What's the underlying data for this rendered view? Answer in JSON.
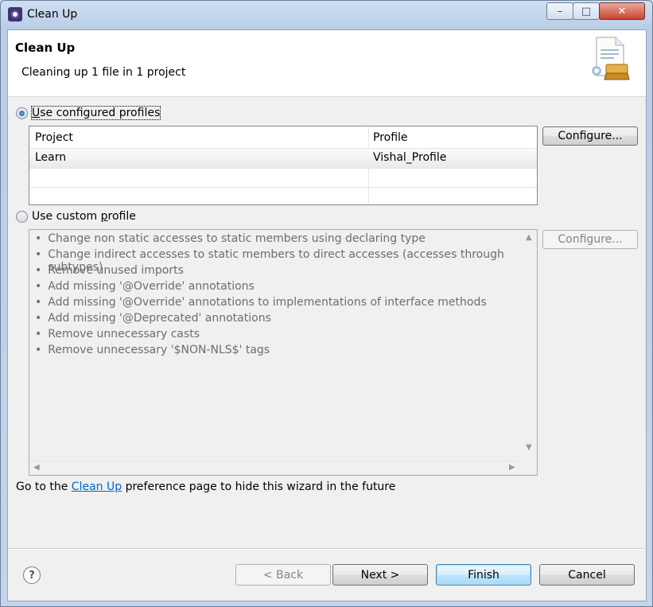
{
  "window": {
    "title": "Clean Up",
    "min_glyph": "–",
    "max_glyph": "□",
    "close_glyph": "✕"
  },
  "banner": {
    "title": "Clean Up",
    "subtitle": "Cleaning up 1 file in 1 project",
    "image_icon": "clean-up-wizard-image"
  },
  "configured": {
    "radio_label_underlined": "U",
    "radio_label_rest": "se configured profiles",
    "selected": true,
    "columns": [
      "Project",
      "Profile"
    ],
    "rows": [
      {
        "project": "Learn",
        "profile": "Vishal_Profile"
      }
    ],
    "configure_label": "Configure..."
  },
  "custom": {
    "radio_label_pre": "Use custom ",
    "radio_label_underlined": "p",
    "radio_label_rest": "rofile",
    "selected": false,
    "configure_label": "Configure...",
    "bullet": "•",
    "items": [
      "Change non static accesses to static members using declaring type",
      "Change indirect accesses to static members to direct accesses (accesses through subtypes)",
      "Remove unused imports",
      "Add missing '@Override' annotations",
      "Add missing '@Override' annotations to implementations of interface methods",
      "Add missing '@Deprecated' annotations",
      "Remove unnecessary casts",
      "Remove unnecessary '$NON-NLS$' tags"
    ]
  },
  "footer": {
    "prefix": "Go to the ",
    "link": "Clean Up",
    "suffix": " preference page to hide this wizard in the future"
  },
  "buttons": {
    "help": "?",
    "back": "< Back",
    "next": "Next >",
    "finish": "Finish",
    "cancel": "Cancel"
  },
  "colors": {
    "link": "#0066cc",
    "close_button": "#c8442f",
    "default_button_border": "#3c7fb1"
  }
}
